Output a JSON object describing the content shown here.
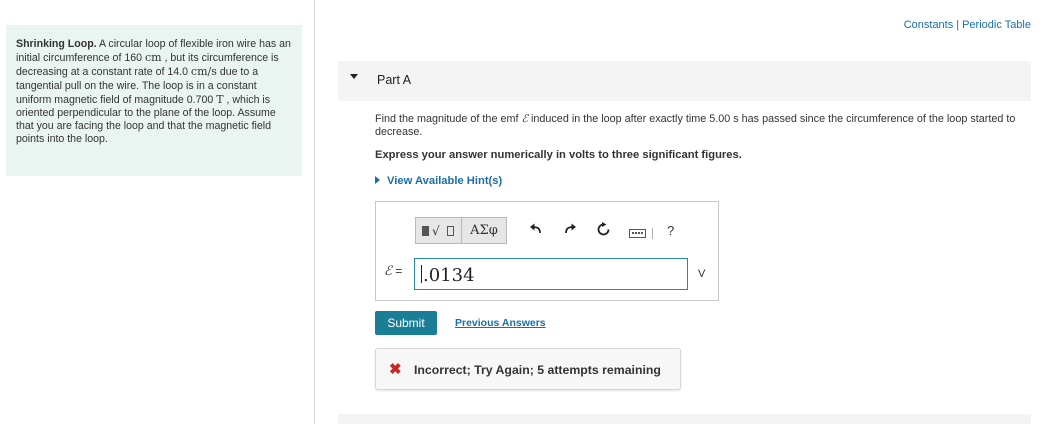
{
  "top_links": {
    "constants": "Constants",
    "separator": "|",
    "periodic_table": "Periodic Table"
  },
  "problem": {
    "title": "Shrinking Loop.",
    "text_1": " A circular loop of flexible iron wire has an initial circumference of 160 ",
    "unit_cm": "cm",
    "text_2": " , but its circumference is decreasing at a constant rate of 14.0 ",
    "unit_cms": "cm/s",
    "text_3": " due to a tangential pull on the wire. The loop is in a constant uniform magnetic field of magnitude 0.700 ",
    "unit_T": "T",
    "text_4": " , which is oriented perpendicular to the plane of the loop. Assume that you are facing the loop and that the magnetic field points into the loop."
  },
  "part": {
    "title": "Part A"
  },
  "question": {
    "text_1": "Find the magnitude of the emf ",
    "symbol": "ℰ",
    "text_2": " induced in the loop after exactly time 5.00 s has passed since the circumference of the loop started to decrease."
  },
  "instruction": "Express your answer numerically in volts to three significant figures.",
  "hints_label": "View Available Hint(s)",
  "toolbar": {
    "template_glyph": "√",
    "greek_label": "ΑΣφ",
    "undo_icon": "undo-icon",
    "redo_icon": "redo-icon",
    "reset_icon": "reset-icon",
    "keyboard_icon": "keyboard-icon",
    "help_label": "?"
  },
  "answer": {
    "label_symbol": "ℰ",
    "label_equals": " =",
    "value": ".0134",
    "unit": "V"
  },
  "submit_label": "Submit",
  "previous_answers_label": "Previous Answers",
  "feedback": {
    "icon": "✖",
    "message": "Incorrect; Try Again; 5 attempts remaining",
    "icon_color": "#d0221e"
  },
  "colors": {
    "panel_bg": "#eaf4f1",
    "link": "#1b6fa3",
    "submit_bg": "#1a7f96"
  }
}
